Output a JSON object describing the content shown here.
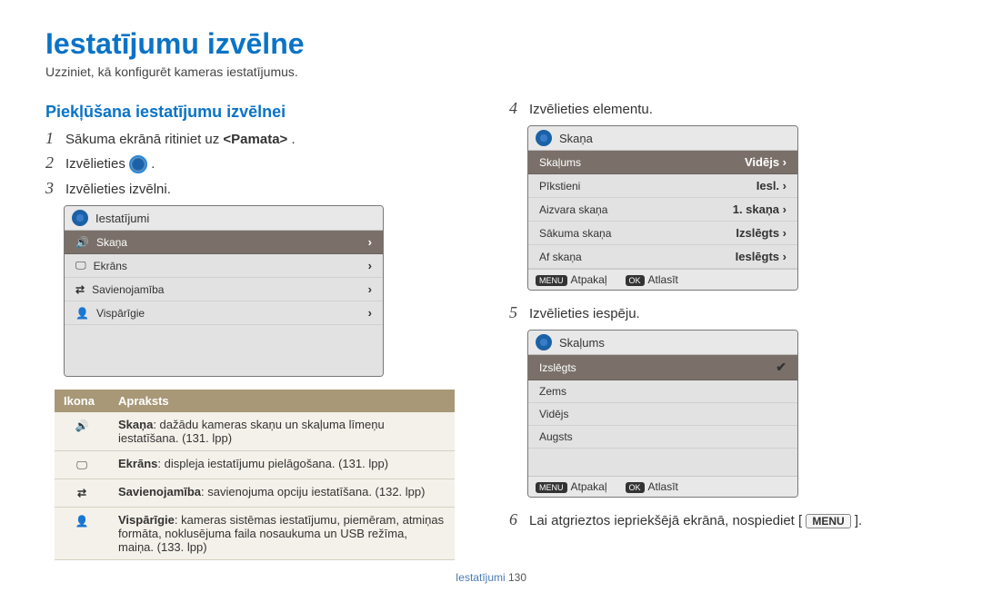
{
  "page": {
    "title": "Iestatījumu izvēlne",
    "subtitle": "Uzziniet, kā konfigurēt kameras iestatījumus."
  },
  "left": {
    "subheading": "Piekļūšana iestatījumu izvēlnei",
    "steps": {
      "s1_num": "1",
      "s1_pre": "Sākuma ekrānā ritiniet uz ",
      "s1_bold": "<Pamata>",
      "s1_post": ".",
      "s2_num": "2",
      "s2_pre": "Izvēlieties ",
      "s2_post": " .",
      "s3_num": "3",
      "s3_text": "Izvēlieties izvēlni."
    },
    "panel1": {
      "title": "Iestatījumi",
      "rows": {
        "r1": "Skaņa",
        "r2": "Ekrāns",
        "r3": "Savienojamība",
        "r4": "Vispārīgie"
      }
    },
    "legend": {
      "h_icon": "Ikona",
      "h_desc": "Apraksts",
      "d1_b": "Skaņa",
      "d1_t": ": dažādu kameras skaņu un skaļuma līmeņu iestatīšana. (131. lpp)",
      "d2_b": "Ekrāns",
      "d2_t": ": displeja iestatījumu pielāgošana. (131. lpp)",
      "d3_b": "Savienojamība",
      "d3_t": ": savienojuma opciju iestatīšana. (132. lpp)",
      "d4_b": "Vispārīgie",
      "d4_t": ": kameras sistēmas iestatījumu, piemēram, atmiņas formāta, noklusējuma faila nosaukuma un USB režīma, maiņa. (133. lpp)"
    }
  },
  "right": {
    "steps": {
      "s4_num": "4",
      "s4_text": "Izvēlieties elementu.",
      "s5_num": "5",
      "s5_text": "Izvēlieties iespēju.",
      "s6_num": "6",
      "s6_pre": "Lai atgrieztos iepriekšējā ekrānā, nospiediet [",
      "s6_btn": "MENU",
      "s6_post": "]."
    },
    "panel2": {
      "title": "Skaņa",
      "rows": {
        "k1": "Skaļums",
        "v1": "Vidējs",
        "k2": "Pīkstieni",
        "v2": "Iesl.",
        "k3": "Aizvara skaņa",
        "v3": "1. skaņa",
        "k4": "Sākuma skaņa",
        "v4": "Izslēgts",
        "k5": "Af skaņa",
        "v5": "Ieslēgts"
      },
      "footer_back": "Atpakaļ",
      "footer_ok": "Atlasīt",
      "menu_key": "MENU",
      "ok_key": "OK"
    },
    "panel3": {
      "title": "Skaļums",
      "rows": {
        "k1": "Izslēgts",
        "k2": "Zems",
        "k3": "Vidējs",
        "k4": "Augsts"
      },
      "footer_back": "Atpakaļ",
      "footer_ok": "Atlasīt",
      "menu_key": "MENU",
      "ok_key": "OK"
    }
  },
  "footer": {
    "section": "Iestatījumi",
    "page": "130"
  }
}
